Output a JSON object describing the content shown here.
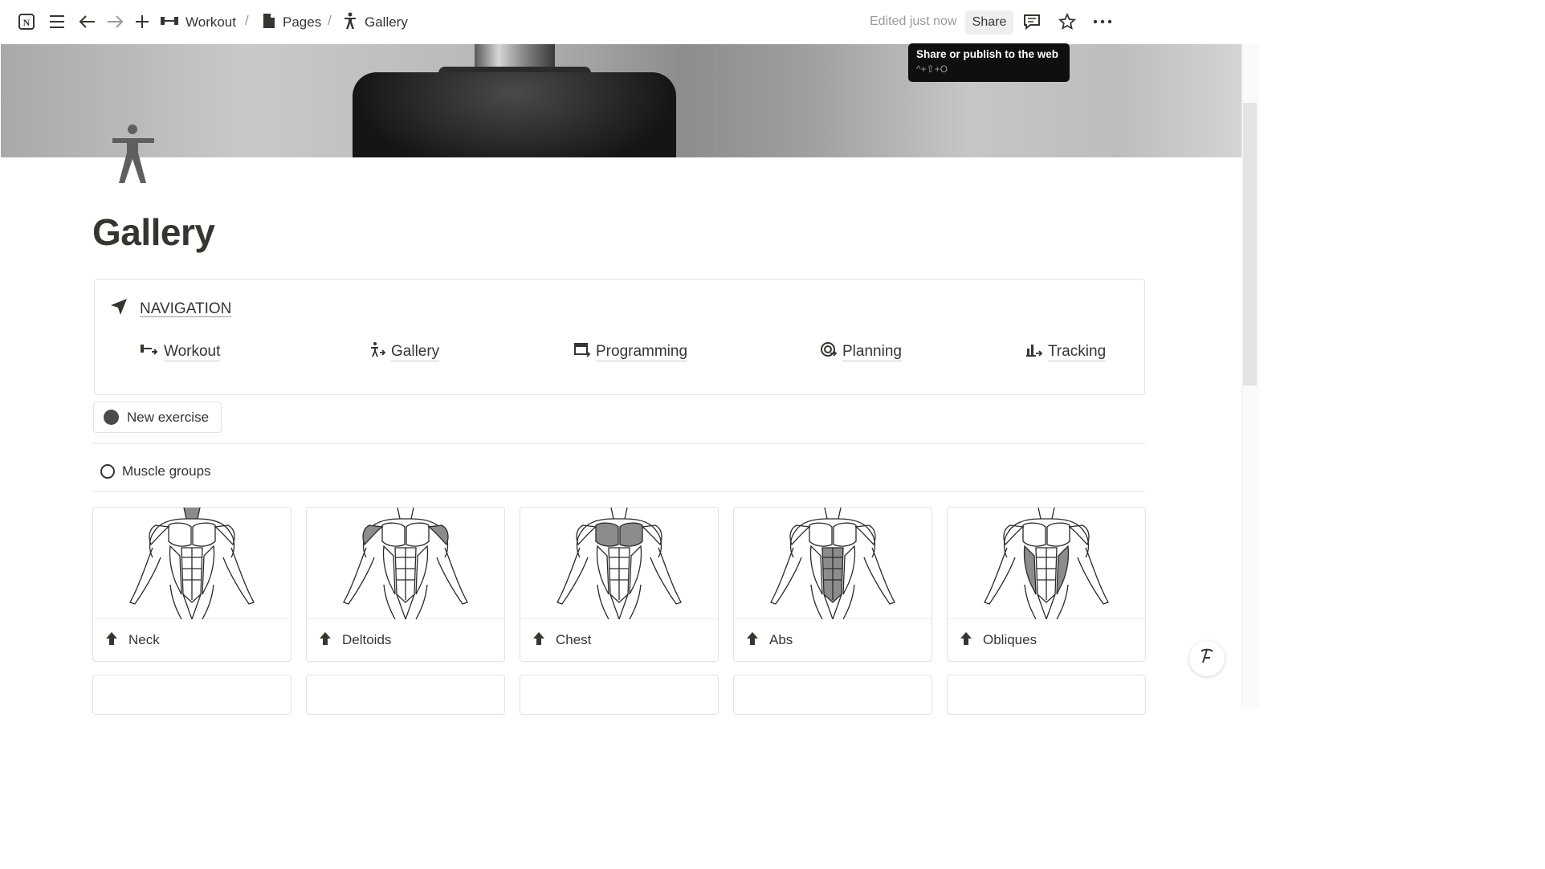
{
  "topbar": {
    "breadcrumbs": [
      {
        "label": "Workout",
        "icon": "dumbbell-icon"
      },
      {
        "label": "Pages",
        "icon": "page-icon"
      },
      {
        "label": "Gallery",
        "icon": "person-icon"
      }
    ],
    "separator": "/",
    "edited": "Edited just now",
    "share_label": "Share",
    "tooltip_title": "Share or publish to the web",
    "tooltip_shortcut": "^+⇧+O"
  },
  "page": {
    "title": "Gallery",
    "icon": "person-standing-icon"
  },
  "navigation": {
    "heading": "NAVIGATION",
    "links": [
      {
        "label": "Workout",
        "icon": "workout-icon"
      },
      {
        "label": "Gallery",
        "icon": "gallery-icon"
      },
      {
        "label": "Programming",
        "icon": "calendar-icon"
      },
      {
        "label": "Planning",
        "icon": "target-icon"
      },
      {
        "label": "Tracking",
        "icon": "chart-icon"
      }
    ]
  },
  "new_exercise_label": "New exercise",
  "muscle_groups": {
    "heading": "Muscle groups",
    "cards": [
      {
        "label": "Neck",
        "highlight": "neck"
      },
      {
        "label": "Deltoids",
        "highlight": "deltoids"
      },
      {
        "label": "Chest",
        "highlight": "chest"
      },
      {
        "label": "Abs",
        "highlight": "abs"
      },
      {
        "label": "Obliques",
        "highlight": "obliques"
      }
    ]
  },
  "colors": {
    "text": "#37352f",
    "muted": "#9b9a97",
    "border": "#e3e2e0",
    "highlight": "#8c8c8c"
  }
}
